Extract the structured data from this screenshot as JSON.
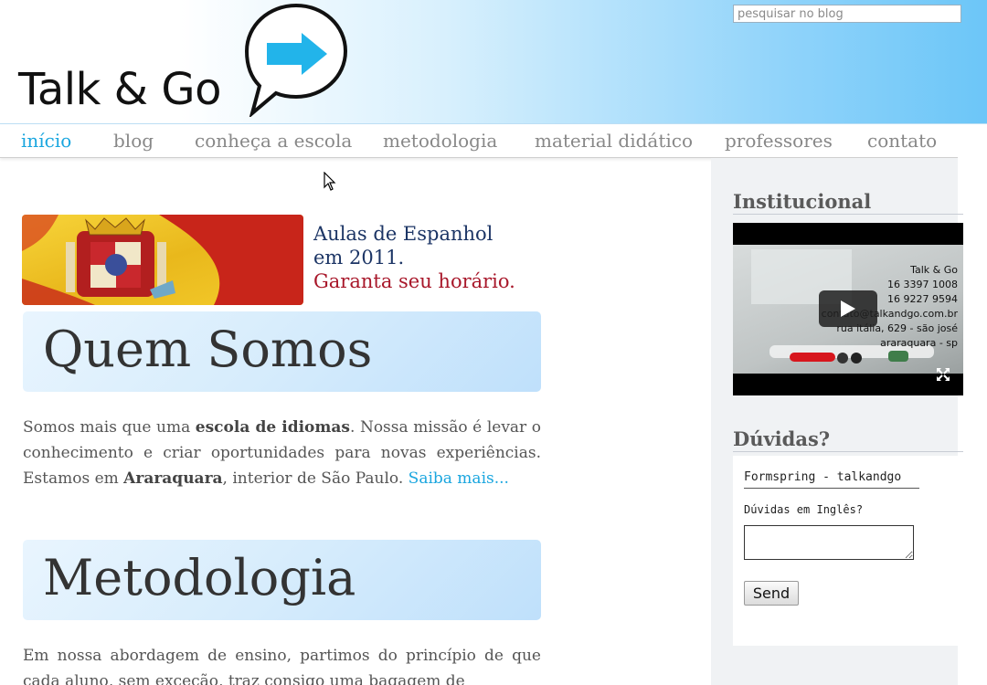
{
  "header": {
    "logo_text": "Talk & Go",
    "search_placeholder": "pesquisar no blog"
  },
  "nav": {
    "items": [
      "início",
      "blog",
      "conheça a escola",
      "metodologia",
      "material didático",
      "professores",
      "contato"
    ],
    "active_index": 0
  },
  "banner": {
    "line1": "Aulas de Espanhol",
    "line2": "em 2011.",
    "line3": "Garanta seu horário."
  },
  "sections": {
    "quem_somos": {
      "title": "Quem Somos",
      "text_1": "Somos mais que uma ",
      "bold_1": "escola de idiomas",
      "text_2": ". Nossa missão é levar o conhecimento e criar oportunidades para novas experiências. Estamos em ",
      "bold_2": "Araraquara",
      "text_3": ", interior de São Paulo. ",
      "link": "Saiba mais..."
    },
    "metodologia": {
      "title": "Metodologia",
      "text": "Em nossa abordagem de ensino, partimos do princípio de que cada aluno, sem exceção, traz consigo uma bagagem de"
    }
  },
  "sidebar": {
    "institucional_title": "Institucional",
    "video": {
      "line1": "Talk & Go",
      "line2": "16 3397 1008",
      "line3": "16 9227 9594",
      "line4": "contato@talkandgo.com.br",
      "line5": "rua itália, 629 - são josé",
      "line6": "araraquara - sp"
    },
    "duvidas_title": "Dúvidas?",
    "form": {
      "title": "Formspring - talkandgo",
      "label": "Dúvidas em Inglês?",
      "send_label": "Send"
    }
  },
  "colors": {
    "accent": "#1aa6df",
    "nav_text": "#888888",
    "banner_blue": "#1c3565",
    "banner_red": "#a8172a"
  }
}
